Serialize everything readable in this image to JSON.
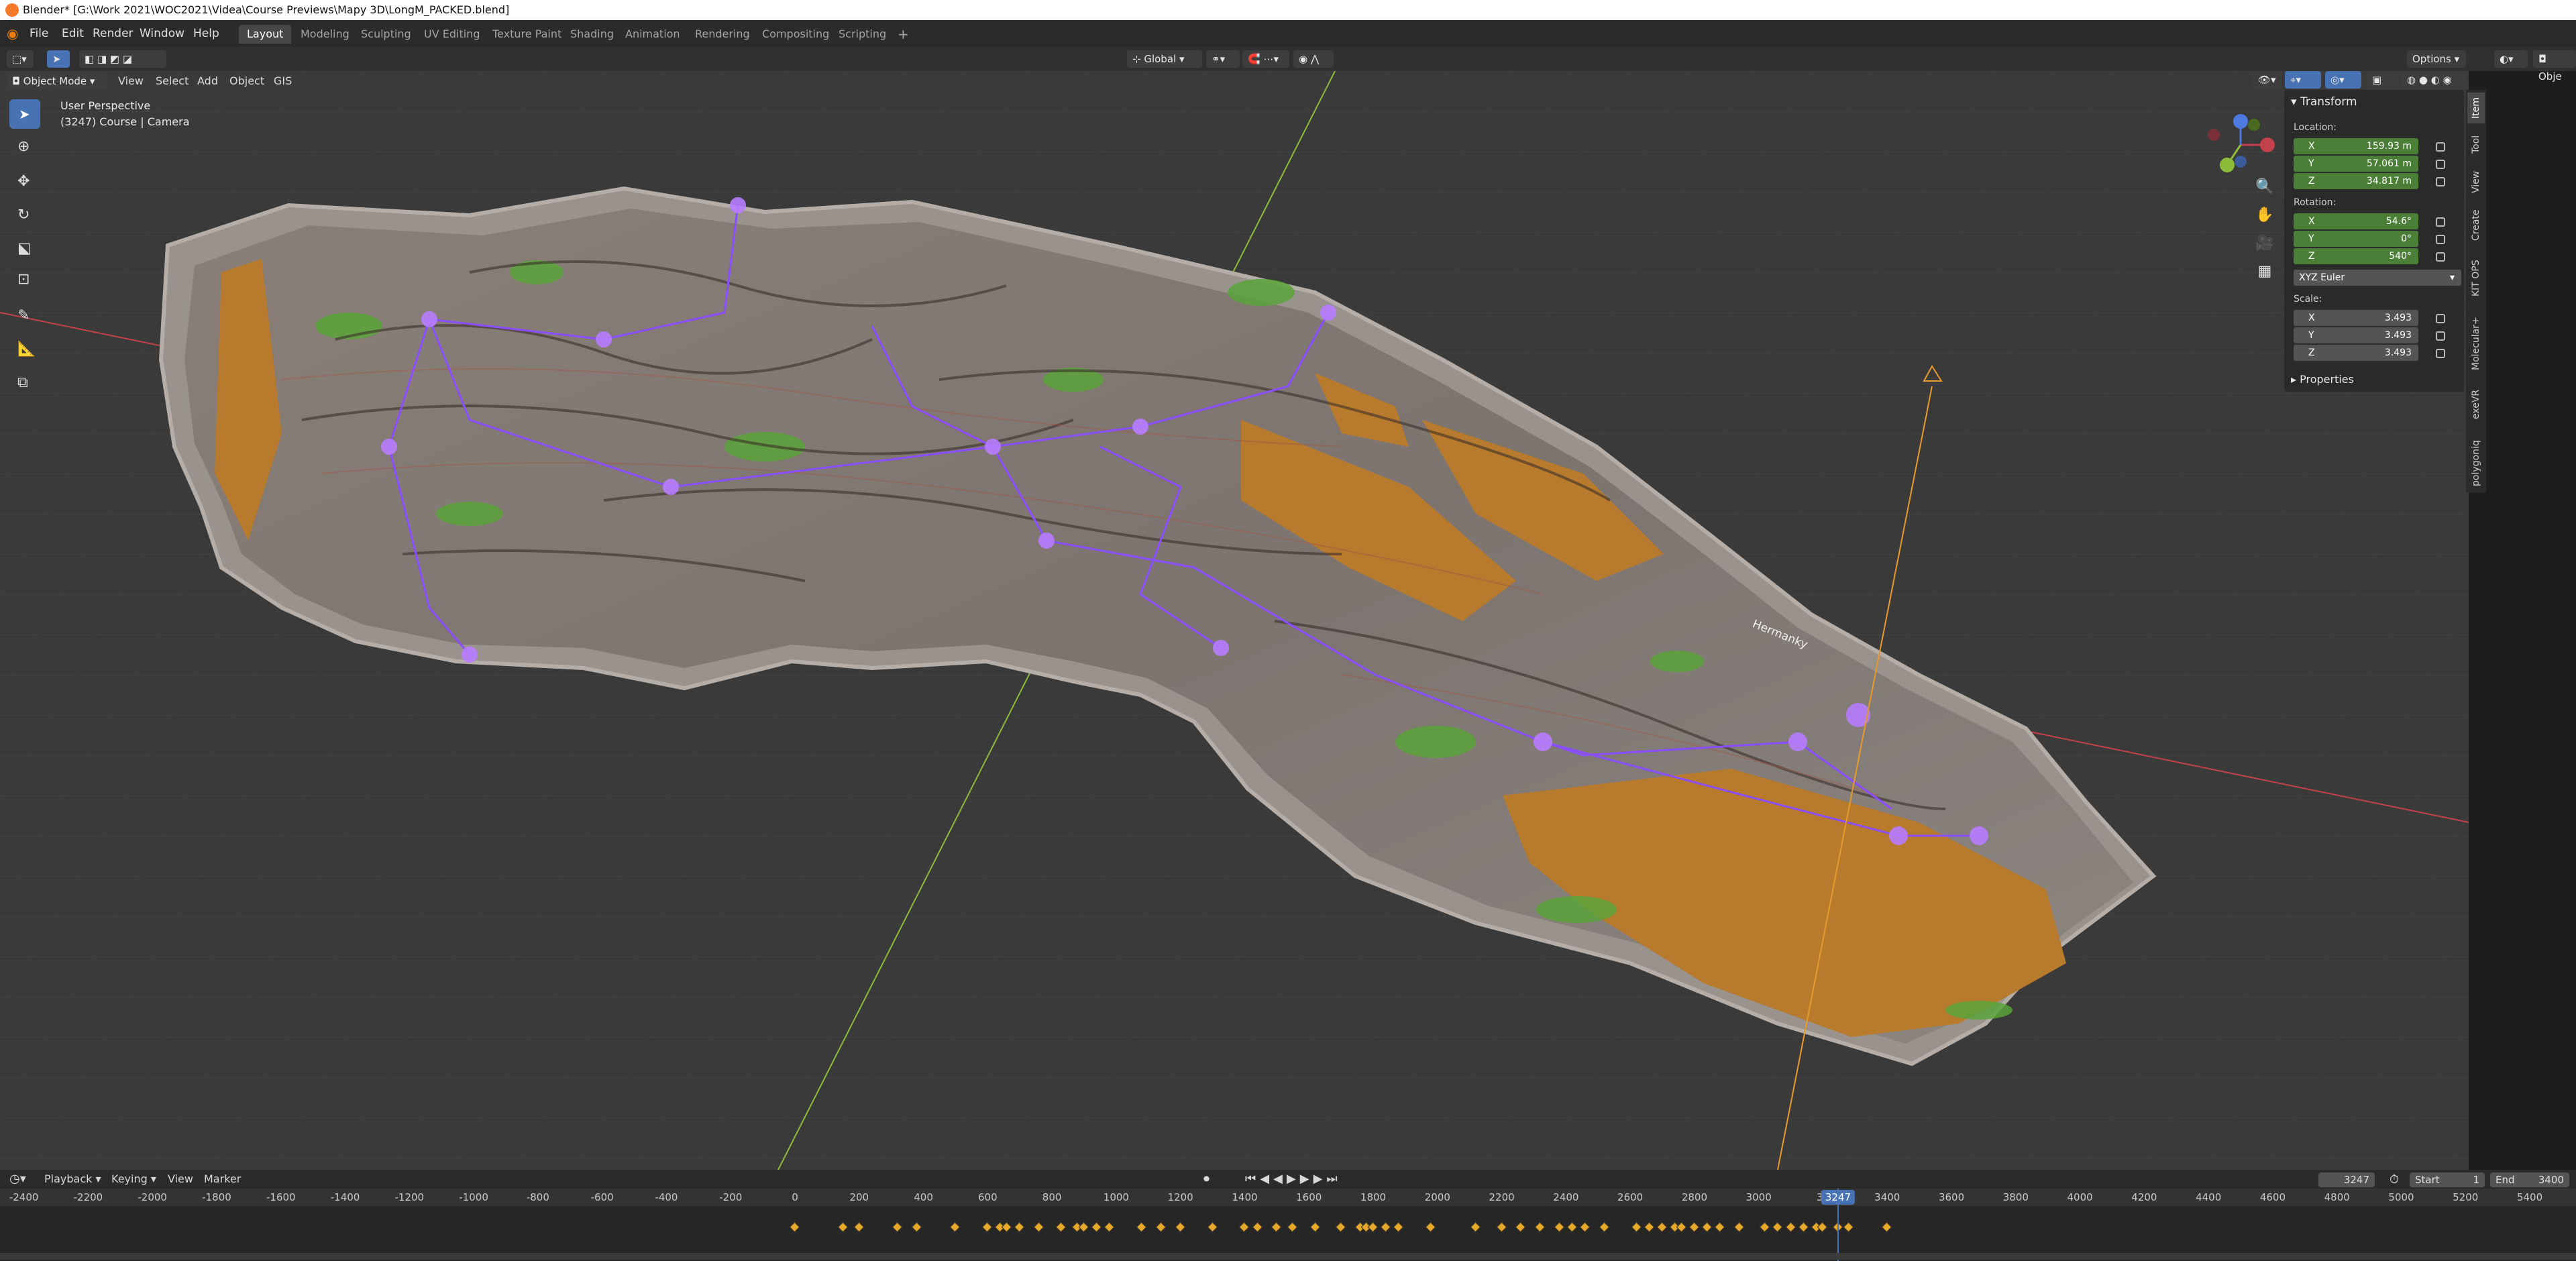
{
  "window": {
    "title": "Blender* [G:\\Work 2021\\WOC2021\\Videa\\Course Previews\\Mapy 3D\\LongM_PACKED.blend]"
  },
  "menubar": {
    "menus": [
      "File",
      "Edit",
      "Render",
      "Window",
      "Help"
    ],
    "workspaces": [
      "Layout",
      "Modeling",
      "Sculpting",
      "UV Editing",
      "Texture Paint",
      "Shading",
      "Animation",
      "Rendering",
      "Compositing",
      "Scripting"
    ],
    "active_workspace": "Layout",
    "add_workspace": "+"
  },
  "header": {
    "transform_orientation": "Global",
    "options_label": "Options",
    "object_label": "Obje"
  },
  "viewport_header": {
    "mode": "Object Mode",
    "menus": [
      "View",
      "Select",
      "Add",
      "Object",
      "GIS"
    ]
  },
  "viewport": {
    "perspective_label": "User Perspective",
    "object_info": "(3247) Course | Camera",
    "map_label": "Hermanky"
  },
  "npanel": {
    "transform_title": "Transform",
    "location_label": "Location:",
    "location": [
      {
        "axis": "X",
        "value": "159.93 m"
      },
      {
        "axis": "Y",
        "value": "57.061 m"
      },
      {
        "axis": "Z",
        "value": "34.817 m"
      }
    ],
    "rotation_label": "Rotation:",
    "rotation": [
      {
        "axis": "X",
        "value": "54.6°"
      },
      {
        "axis": "Y",
        "value": "0°"
      },
      {
        "axis": "Z",
        "value": "540°"
      }
    ],
    "rotation_mode": "XYZ Euler",
    "scale_label": "Scale:",
    "scale": [
      {
        "axis": "X",
        "value": "3.493"
      },
      {
        "axis": "Y",
        "value": "3.493"
      },
      {
        "axis": "Z",
        "value": "3.493"
      }
    ],
    "properties_title": "Properties",
    "tabs": [
      "Item",
      "Tool",
      "View",
      "Create",
      "KIT OPS",
      "Molecular+",
      "exeVR",
      "polygoniq"
    ],
    "active_tab": "Item"
  },
  "timeline": {
    "menus": [
      "Playback",
      "Keying",
      "View",
      "Marker"
    ],
    "current_frame": "3247",
    "start_label": "Start",
    "start": "1",
    "end_label": "End",
    "end": "3400",
    "ruler_labels": [
      "-2400",
      "-2200",
      "-2000",
      "-1800",
      "-1600",
      "-1400",
      "-1200",
      "-1000",
      "-800",
      "-600",
      "-400",
      "-200",
      "0",
      "200",
      "400",
      "600",
      "800",
      "1000",
      "1200",
      "1400",
      "1600",
      "1800",
      "2000",
      "2200",
      "2400",
      "2600",
      "2800",
      "3000",
      "32",
      "3400",
      "3600",
      "3800",
      "4000",
      "4200",
      "4400",
      "4600",
      "4800",
      "5000",
      "5200",
      "5400"
    ],
    "keyframes": [
      0,
      150,
      200,
      320,
      380,
      500,
      600,
      640,
      660,
      700,
      760,
      830,
      880,
      900,
      940,
      980,
      1080,
      1140,
      1200,
      1300,
      1400,
      1440,
      1500,
      1550,
      1620,
      1700,
      1760,
      1780,
      1800,
      1840,
      1880,
      1980,
      2120,
      2200,
      2260,
      2320,
      2380,
      2420,
      2460,
      2520,
      2620,
      2660,
      2700,
      2740,
      2760,
      2800,
      2840,
      2880,
      2940,
      3020,
      3060,
      3100,
      3140,
      3180,
      3200,
      3247,
      3280,
      3400
    ]
  },
  "colors": {
    "accent": "#4772b3",
    "field_green": "#4b7f37",
    "keyframe": "#e8a82a",
    "x_axis": "#c2414b",
    "y_axis": "#8dbb3a",
    "camera": "#e89a2a",
    "path_purple": "#8a4dff",
    "terrain_orange": "#b87a2c"
  }
}
